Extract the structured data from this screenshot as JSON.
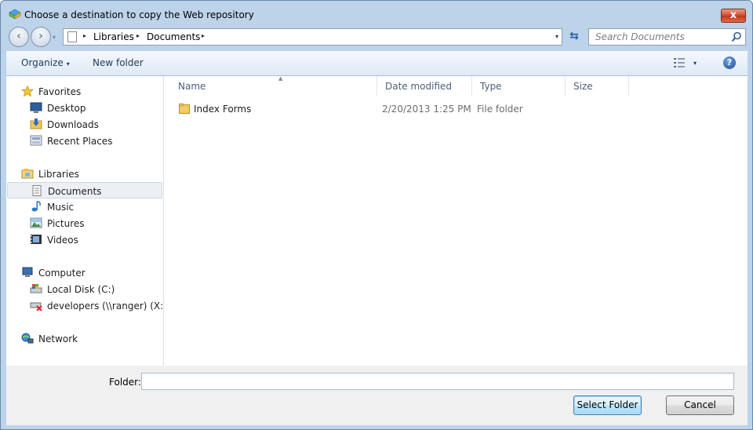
{
  "window": {
    "title": "Choose a destination to copy the Web repository",
    "close_glyph": "x"
  },
  "address": {
    "segments": [
      "Libraries",
      "Documents"
    ],
    "separator_glyph": "▸",
    "dropdown_glyph": "▾"
  },
  "search": {
    "placeholder": "Search Documents"
  },
  "toolbar": {
    "organize_label": "Organize",
    "new_folder_label": "New folder",
    "caret_glyph": "▾",
    "help_glyph": "?"
  },
  "nav": {
    "favorites": {
      "label": "Favorites",
      "items": [
        {
          "label": "Desktop",
          "icon": "desktop-icon"
        },
        {
          "label": "Downloads",
          "icon": "downloads-icon"
        },
        {
          "label": "Recent Places",
          "icon": "recent-places-icon"
        }
      ]
    },
    "libraries": {
      "label": "Libraries",
      "items": [
        {
          "label": "Documents",
          "icon": "documents-icon",
          "selected": true
        },
        {
          "label": "Music",
          "icon": "music-icon"
        },
        {
          "label": "Pictures",
          "icon": "pictures-icon"
        },
        {
          "label": "Videos",
          "icon": "videos-icon"
        }
      ]
    },
    "computer": {
      "label": "Computer",
      "items": [
        {
          "label": "Local Disk (C:)",
          "icon": "local-disk-icon"
        },
        {
          "label": "developers (\\\\ranger) (X:)",
          "icon": "disconnected-drive-icon"
        }
      ]
    },
    "network": {
      "label": "Network"
    }
  },
  "columns": {
    "name": "Name",
    "date_modified": "Date modified",
    "type": "Type",
    "size": "Size"
  },
  "files": [
    {
      "name": "Index Forms",
      "date_modified": "2/20/2013 1:25 PM",
      "type": "File folder",
      "size": ""
    }
  ],
  "footer": {
    "folder_label": "Folder:",
    "folder_value": "",
    "select_button": "Select Folder",
    "cancel_button": "Cancel"
  },
  "colors": {
    "frame": "#bcd3ea",
    "toolbar_text": "#1e395b",
    "selection": "#ecf0f5"
  }
}
